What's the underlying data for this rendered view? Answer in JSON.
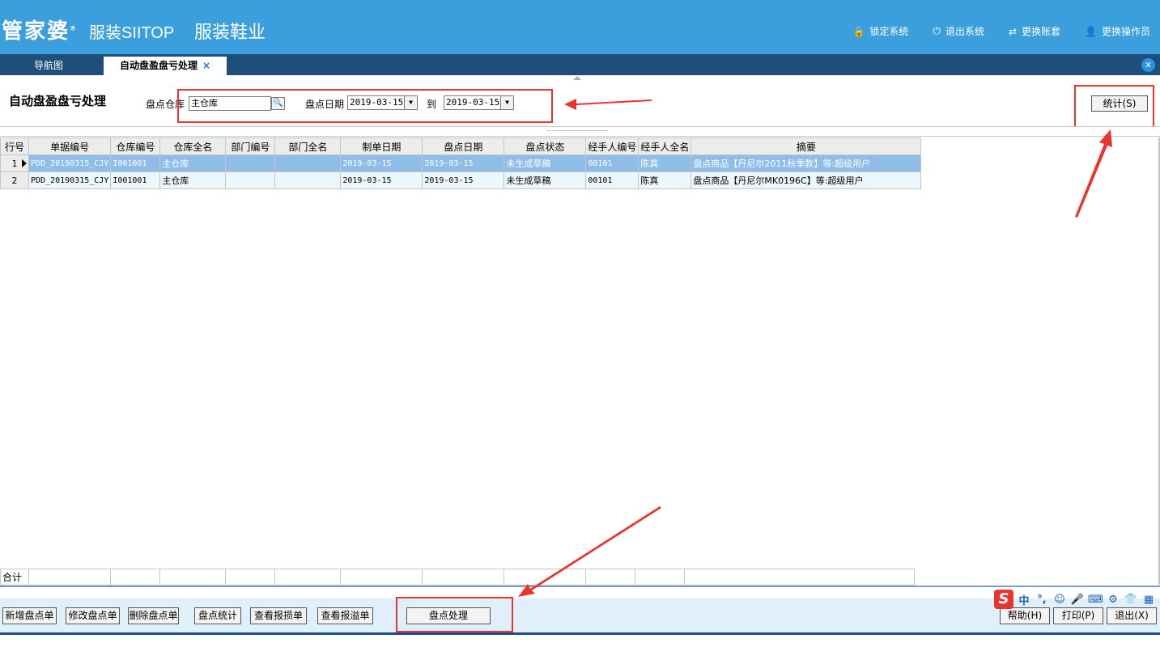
{
  "header": {
    "logo": "管家婆",
    "brand": "服装SIITOP",
    "brand_sub": "服装鞋业",
    "actions": [
      {
        "label": "锁定系统",
        "icon": "lock-icon"
      },
      {
        "label": "退出系统",
        "icon": "power-icon"
      },
      {
        "label": "更换账套",
        "icon": "swap-icon"
      },
      {
        "label": "更换操作员",
        "icon": "user-icon"
      }
    ]
  },
  "tabs": {
    "nav": "导航图",
    "active": "自动盘盈盘亏处理",
    "close": "×"
  },
  "filter": {
    "page_title": "自动盘盈盘亏处理",
    "warehouse_label": "盘点仓库",
    "warehouse_value": "主仓库",
    "date_label": "盘点日期",
    "date_from": "2019-03-15",
    "to_label": "到",
    "date_to": "2019-03-15",
    "stat_button": "统计(S)"
  },
  "grid": {
    "columns": [
      "行号",
      "单据编号",
      "仓库编号",
      "仓库全名",
      "部门编号",
      "部门全名",
      "制单日期",
      "盘点日期",
      "盘点状态",
      "经手人编号",
      "经手人全名",
      "摘要"
    ],
    "rows": [
      [
        "1",
        "PDD_20190315_CJY",
        "I001001",
        "主仓库",
        "",
        "",
        "2019-03-15",
        "2019-03-15",
        "未生成草稿",
        "00101",
        "陈真",
        "盘点商品【丹尼尔2011秋季款】等:超级用户"
      ],
      [
        "2",
        "PDD_20190315_CJY",
        "I001001",
        "主仓库",
        "",
        "",
        "2019-03-15",
        "2019-03-15",
        "未生成草稿",
        "00101",
        "陈真",
        "盘点商品【丹尼尔MK0196C】等:超级用户"
      ]
    ],
    "footer_label": "合计"
  },
  "toolbar": {
    "new_check": "新增盘点单",
    "edit_check": "修改盘点单",
    "delete_check": "删除盘点单",
    "check_stats": "盘点统计",
    "view_loss": "查看报损单",
    "view_gain": "查看报溢单",
    "process": "盘点处理",
    "help": "帮助(H)",
    "print": "打印(P)",
    "exit": "退出(X)"
  },
  "ime": {
    "logo": "S",
    "lang": "中",
    "punct": "°,"
  },
  "colors": {
    "header_bg": "#3a9fdc",
    "tabbar_bg": "#1f4e79",
    "selected_row": "#8ebde8",
    "annotation_red": "#e8352f",
    "toolbar_bg": "#dff0fb"
  }
}
